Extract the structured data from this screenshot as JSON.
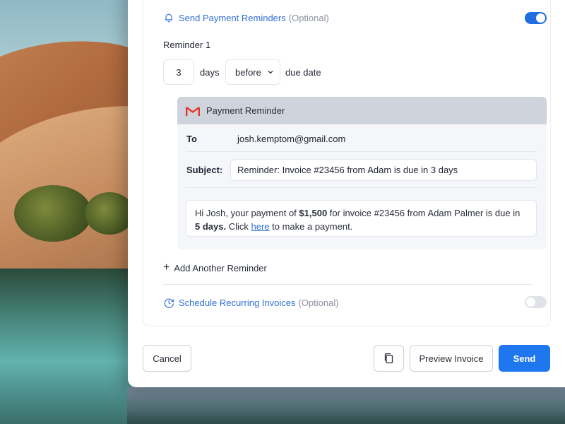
{
  "payment_reminders": {
    "title": "Send Payment Reminders",
    "optional": "(Optional)",
    "enabled": true
  },
  "reminder": {
    "label": "Reminder 1",
    "days_value": "3",
    "days_unit": "days",
    "when": "before",
    "suffix": "due date"
  },
  "email": {
    "header": "Payment Reminder",
    "to_label": "To",
    "to_value": "josh.kemptom@gmail.com",
    "subject_label": "Subject:",
    "subject_value": "Reminder: Invoice #23456 from Adam is due in 3 days",
    "body": {
      "part1": "Hi Josh, your payment of ",
      "amount": "$1,500",
      "part2": " for invoice #23456 from Adam Palmer is due in ",
      "due": "5 days.",
      "part3": " Click ",
      "link": "here",
      "part4": " to make a payment."
    }
  },
  "add_reminder": {
    "plus": "+",
    "label": "Add Another Reminder"
  },
  "recurring": {
    "title": "Schedule Recurring Invoices",
    "optional": "(Optional)",
    "enabled": false
  },
  "footer": {
    "cancel": "Cancel",
    "preview": "Preview Invoice",
    "send": "Send"
  },
  "colors": {
    "accent": "#1f77ef",
    "link": "#2f6fd6"
  }
}
